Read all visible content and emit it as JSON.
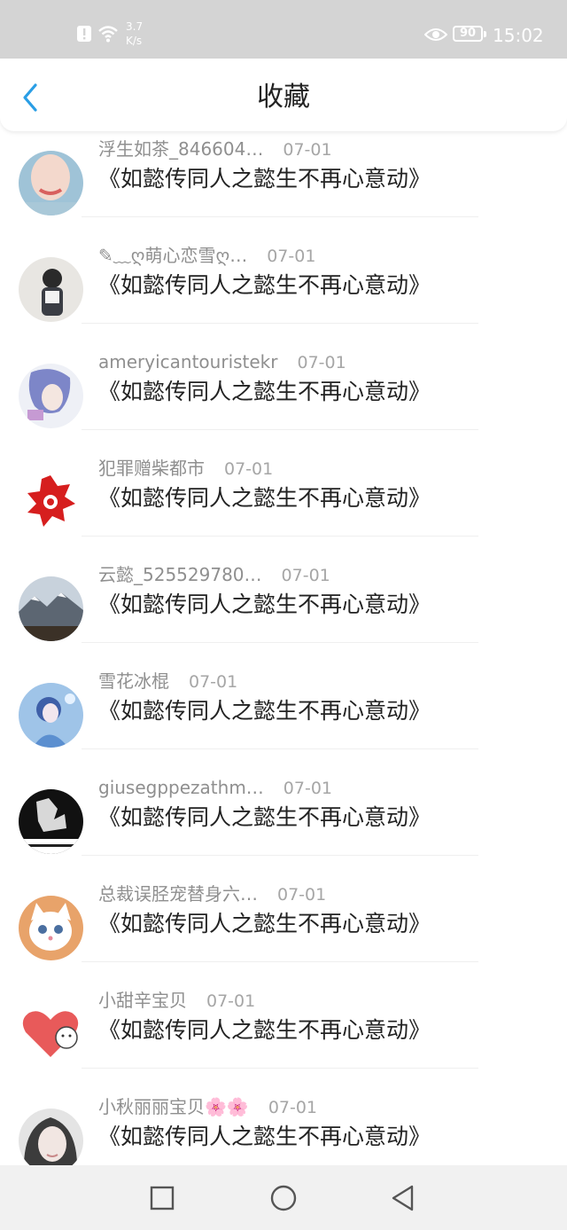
{
  "status_bar": {
    "net_speed_value": "3.7",
    "net_speed_unit": "K/s",
    "battery": "90",
    "time": "15:02",
    "icons": [
      "alert-icon",
      "wifi-icon",
      "eye-icon",
      "battery-icon"
    ]
  },
  "header": {
    "title": "收藏",
    "back_icon": "chevron-left-icon",
    "accent_color": "#2a9ee5"
  },
  "favorites": [
    {
      "user": "浮生如茶_846604…",
      "date": "07-01",
      "title": "《如懿传同人之懿生不再心意动》"
    },
    {
      "user": "✎﹏ღ萌心恋雪ღ…",
      "date": "07-01",
      "title": "《如懿传同人之懿生不再心意动》"
    },
    {
      "user": "ameryicantouristekr",
      "date": "07-01",
      "title": "《如懿传同人之懿生不再心意动》"
    },
    {
      "user": "犯罪赠柴都市",
      "date": "07-01",
      "title": "《如懿传同人之懿生不再心意动》"
    },
    {
      "user": "云懿_525529780…",
      "date": "07-01",
      "title": "《如懿传同人之懿生不再心意动》"
    },
    {
      "user": "雪花冰棍",
      "date": "07-01",
      "title": "《如懿传同人之懿生不再心意动》"
    },
    {
      "user": "giusegppezathm…",
      "date": "07-01",
      "title": "《如懿传同人之懿生不再心意动》"
    },
    {
      "user": "总裁误胫宠替身六…",
      "date": "07-01",
      "title": "《如懿传同人之懿生不再心意动》"
    },
    {
      "user": "小甜辛宝贝",
      "date": "07-01",
      "title": "《如懿传同人之懿生不再心意动》"
    },
    {
      "user": "小秋丽丽宝贝🌸🌸",
      "date": "07-01",
      "title": "《如懿传同人之懿生不再心意动》"
    }
  ],
  "nav_bar": {
    "icons": [
      "square-recents-icon",
      "circle-home-icon",
      "triangle-back-icon"
    ]
  }
}
